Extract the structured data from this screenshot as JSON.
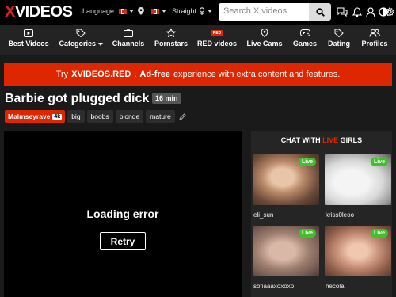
{
  "header": {
    "logo_x": "X",
    "logo_rest": "VIDEOS",
    "language_label": "Language:",
    "orientation_label": "Straight",
    "search_placeholder": "Search X videos"
  },
  "nav": [
    {
      "label": "Best Videos",
      "icon": "play-icon"
    },
    {
      "label": "Categories",
      "icon": "tag-icon"
    },
    {
      "label": "Channels",
      "icon": "tv-icon"
    },
    {
      "label": "Pornstars",
      "icon": "star-icon"
    },
    {
      "label": "RED videos",
      "icon": "red-tag-icon",
      "badge": "RED"
    },
    {
      "label": "Live Cams",
      "icon": "pin-icon"
    },
    {
      "label": "Games",
      "icon": "gamepad-icon"
    },
    {
      "label": "Dating",
      "icon": "tag-icon"
    },
    {
      "label": "Profiles",
      "icon": "users-icon"
    }
  ],
  "promo": {
    "prefix": "Try",
    "brand": "XVIDEOS.RED",
    "bold": "Ad-free",
    "suffix": "experience with extra content and features."
  },
  "video": {
    "title": "Barbie got plugged dick",
    "duration": "16 min",
    "uploader": "Malmseyrave",
    "subscribers": "4k",
    "tags": [
      "big",
      "boobs",
      "blonde",
      "mature"
    ]
  },
  "player": {
    "error_text": "Loading error",
    "retry_label": "Retry"
  },
  "cams": {
    "title_prefix": "CHAT WITH",
    "title_live": "LIVE",
    "title_suffix": "GIRLS",
    "live_badge": "Live",
    "items": [
      {
        "name": "eli_sun"
      },
      {
        "name": "kriss0leoo"
      },
      {
        "name": "sofiaaaxoxoxo"
      },
      {
        "name": "hecola"
      }
    ]
  },
  "colors": {
    "accent": "#de2600",
    "live_green": "#3ec12a",
    "background": "#1a1a1a"
  }
}
